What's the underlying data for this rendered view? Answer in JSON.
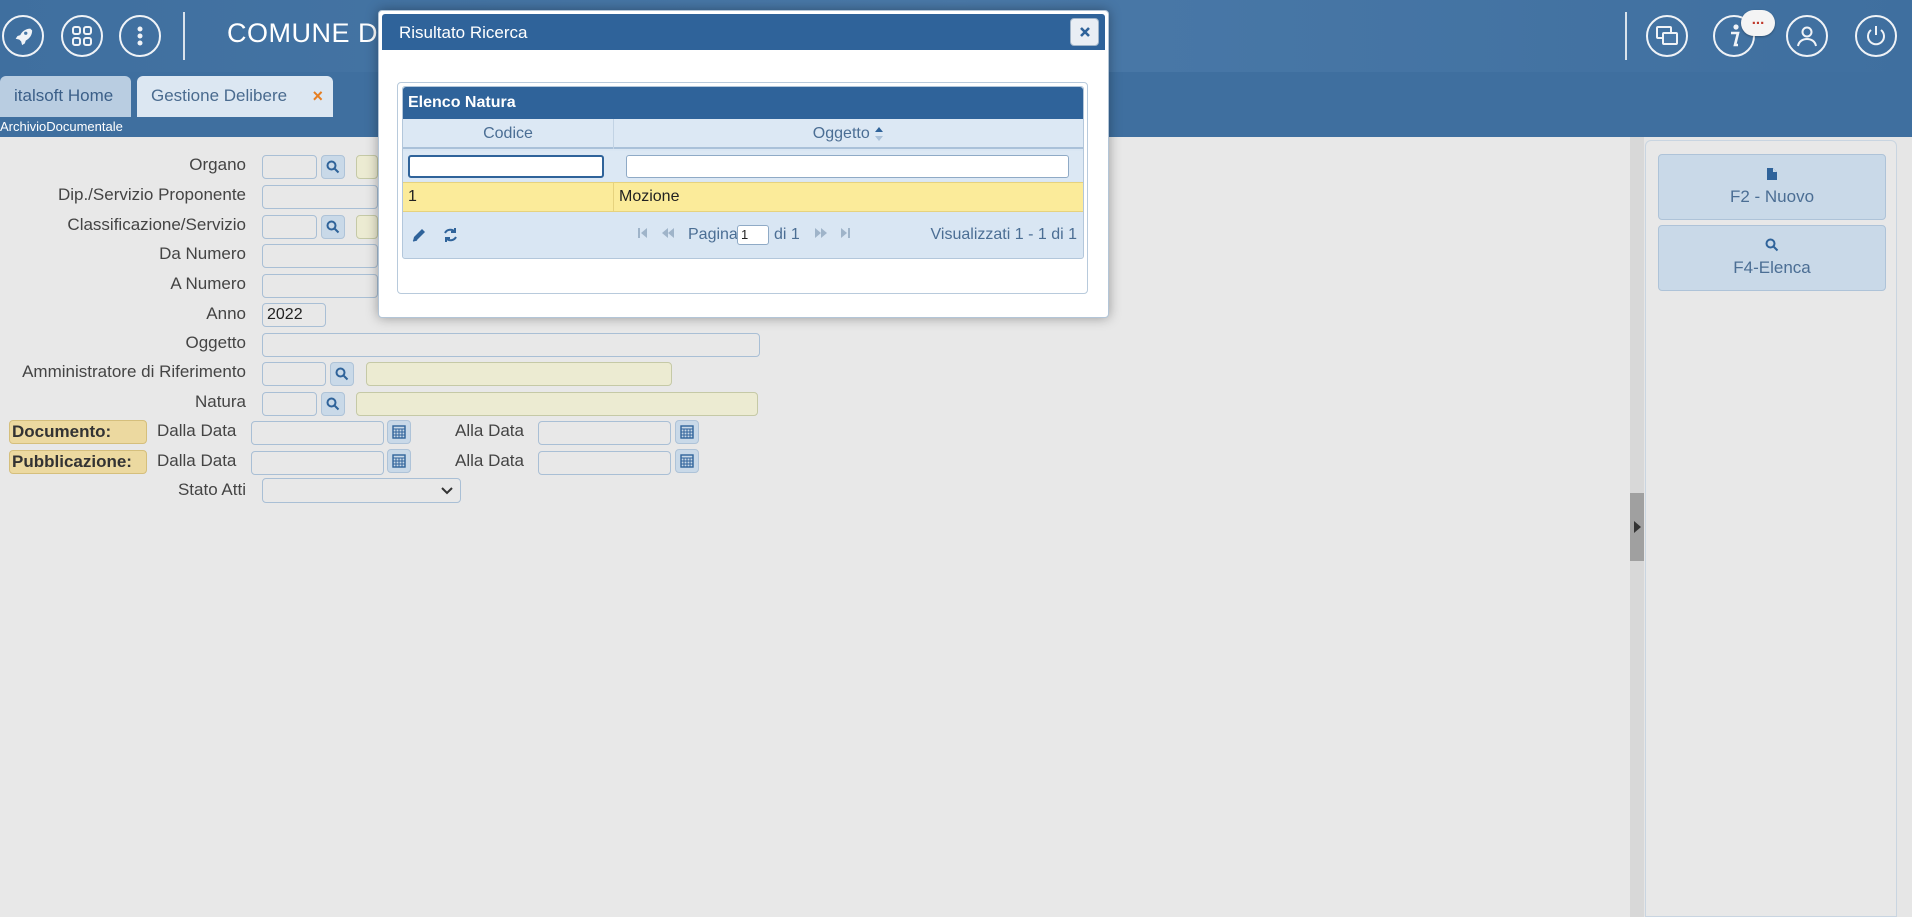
{
  "header": {
    "app_title": "COMUNE DI",
    "notification_badge": "...",
    "icons": [
      "rocket-icon",
      "apps-grid-icon",
      "more-vertical-icon",
      "windows-icon",
      "info-icon",
      "user-icon",
      "power-icon"
    ]
  },
  "tabs": [
    {
      "label": "italsoft Home"
    },
    {
      "label": "Gestione Delibere",
      "close": "×"
    }
  ],
  "breadcrumb": "ArchivioDocumentale",
  "form": {
    "organo": "Organo",
    "dip_servizio": "Dip./Servizio Proponente",
    "classificazione": "Classificazione/Servizio",
    "da_numero": "Da Numero",
    "a_numero": "A Numero",
    "anno": "Anno",
    "anno_value": "2022",
    "oggetto": "Oggetto",
    "amministratore": "Amministratore di Riferimento",
    "natura": "Natura",
    "documento": "Documento:",
    "pubblicazione": "Pubblicazione:",
    "dalla_data": "Dalla Data",
    "alla_data": "Alla Data",
    "stato_atti": "Stato Atti"
  },
  "right_panel": {
    "nuovo": "F2 - Nuovo",
    "elenca": "F4-Elenca"
  },
  "modal": {
    "title": "Risultato Ricerca",
    "close": "×",
    "grid_caption": "Elenco Natura",
    "columns": [
      "Codice",
      "Oggetto"
    ],
    "rows": [
      {
        "codice": "1",
        "oggetto": "Mozione"
      }
    ],
    "pager": {
      "page_label": "Pagina",
      "page_value": "1",
      "of_label": "di 1",
      "summary": "Visualizzati 1 - 1 di 1"
    }
  },
  "colors": {
    "header_blue": "#3f6f9f",
    "modal_blue": "#2f639a",
    "selected_row": "#fbeb9a",
    "accent_orange": "#e67e22"
  }
}
